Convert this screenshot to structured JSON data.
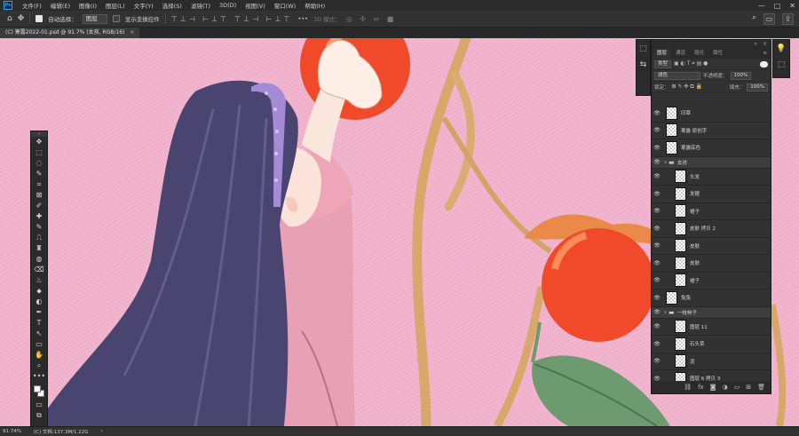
{
  "menubar": {
    "app_icon": "Ps",
    "items": [
      "文件(F)",
      "编辑(E)",
      "图像(I)",
      "图层(L)",
      "文字(Y)",
      "选择(S)",
      "滤镜(T)",
      "3D(D)",
      "视图(V)",
      "窗口(W)",
      "帮助(H)"
    ],
    "window_controls": [
      "—",
      "□",
      "✕"
    ]
  },
  "options": {
    "home_icon": "⌂",
    "move_icon": "✥",
    "auto_select_label": "自动选择：",
    "auto_select_value": "图层",
    "show_transform_label": "显示变换控件",
    "align_glyphs": "⊤⊥⊣ ⊢⊥⊤",
    "more_label": "•••",
    "mode_3d_label": "3D 模式：",
    "search_icon": "⌕",
    "workspace_icon": "▭",
    "share_icon": "⇪"
  },
  "document": {
    "tab_title": "(C) 寒露2022-01.psd @ 91.7% (女孩, RGB/16)",
    "close": "×"
  },
  "tools": [
    "✥",
    "⬚",
    "◌",
    "✎",
    "⌗",
    "⊠",
    "✐",
    "✚",
    "✎",
    "⎍",
    "♜",
    "◍",
    "⌫",
    "♨",
    "⬥",
    "◐",
    "✒",
    "T",
    "↖",
    "▭",
    "✋",
    "⌕",
    "•••"
  ],
  "dock": {
    "left": [
      "⬚",
      "⇆"
    ],
    "right": [
      "💡",
      "⬚"
    ]
  },
  "layers_panel": {
    "collapse": "«",
    "close": "×",
    "menu": "≡",
    "tabs": [
      "图层",
      "通道",
      "路径",
      "属性"
    ],
    "active_tab": 0,
    "filter_type": "类型",
    "blend_mode": "滤色",
    "opacity_label": "不透明度：",
    "opacity_value": "100%",
    "lock_label": "锁定：",
    "fill_label": "填充：",
    "fill_value": "100%",
    "layers": [
      {
        "name": "印章",
        "type": "layer",
        "indent": 0
      },
      {
        "name": "寒露 原创字",
        "type": "layer",
        "indent": 0
      },
      {
        "name": "寒露底色",
        "type": "layer",
        "indent": 0
      },
      {
        "name": "女孩",
        "type": "group",
        "indent": 0
      },
      {
        "name": "头发",
        "type": "layer",
        "indent": 1
      },
      {
        "name": "发箍",
        "type": "layer",
        "indent": 1
      },
      {
        "name": "裙子",
        "type": "layer",
        "indent": 1
      },
      {
        "name": "皮肤 拷贝 2",
        "type": "layer",
        "indent": 1
      },
      {
        "name": "皮肤",
        "type": "layer",
        "indent": 1
      },
      {
        "name": "皮肤",
        "type": "layer",
        "indent": 1
      },
      {
        "name": "裙子",
        "type": "layer",
        "indent": 1
      },
      {
        "name": "兔兔",
        "type": "layer",
        "indent": 0
      },
      {
        "name": "一枝柿子",
        "type": "group",
        "indent": 0
      },
      {
        "name": "图层 11",
        "type": "layer",
        "indent": 1
      },
      {
        "name": "石头草",
        "type": "layer",
        "indent": 1
      },
      {
        "name": "泥",
        "type": "layer",
        "indent": 1
      },
      {
        "name": "图层 6 拷贝 3",
        "type": "layer",
        "indent": 1
      },
      {
        "name": "图层 6 拷贝",
        "type": "layer",
        "indent": 1
      }
    ],
    "footer_icons": [
      "⛓",
      "fx",
      "◙",
      "◑",
      "▭",
      "⊞",
      "🗑"
    ]
  },
  "status": {
    "zoom": "91.74%",
    "doc_info": "(C) 文档:137.3M/1.22G",
    "arrow": "›"
  },
  "colors": {
    "canvas_bg": "#f0b2cc",
    "persimmon": "#f04a2a",
    "hair": "#4a4470",
    "dress": "#e8a0b4"
  }
}
